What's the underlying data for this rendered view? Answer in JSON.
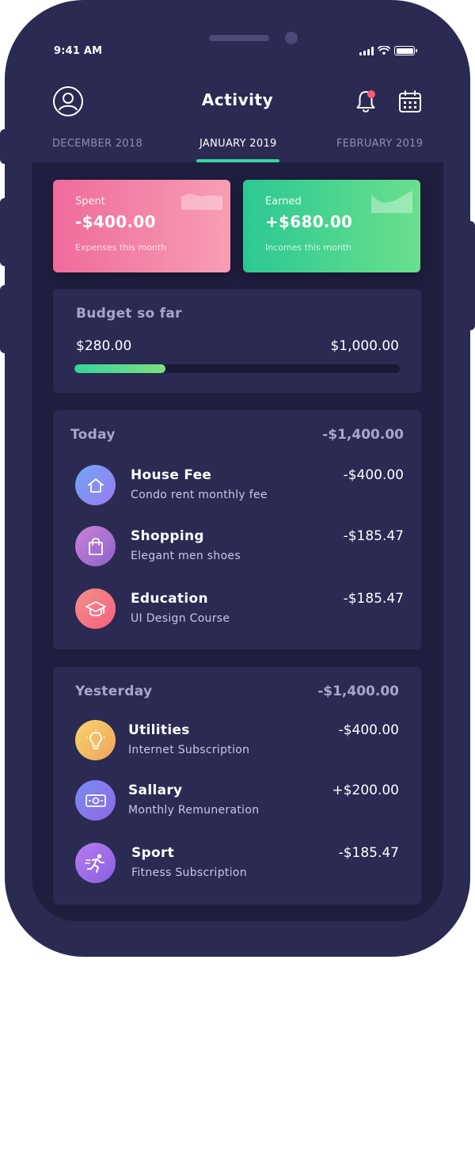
{
  "status_bar": {
    "time": "9:41 AM"
  },
  "header": {
    "title": "Activity"
  },
  "tabs": {
    "prev": "DECEMBER 2018",
    "active": "JANUARY 2019",
    "next": "FEBRUARY 2019"
  },
  "summary": {
    "spent": {
      "label": "Spent",
      "amount": "-$400.00",
      "sub": "Expenses this month"
    },
    "earned": {
      "label": "Earned",
      "amount": "+$680.00",
      "sub": "Incomes this month"
    }
  },
  "budget": {
    "title": "Budget so far",
    "spent": "$280.00",
    "limit": "$1,000.00",
    "progress_fraction": 0.28
  },
  "today": {
    "title": "Today",
    "total": "-$1,400.00",
    "items": [
      {
        "name": "House Fee",
        "desc": "Condo rent monthly fee",
        "amount": "-$400.00",
        "icon": "house-icon"
      },
      {
        "name": "Shopping",
        "desc": "Elegant men shoes",
        "amount": "-$185.47",
        "icon": "shopping-bag-icon"
      },
      {
        "name": "Education",
        "desc": "UI Design Course",
        "amount": "-$185.47",
        "icon": "graduation-cap-icon"
      }
    ]
  },
  "yesterday": {
    "title": "Yesterday",
    "total": "-$1,400.00",
    "items": [
      {
        "name": "Utilities",
        "desc": "Internet Subscription",
        "amount": "-$400.00",
        "icon": "lightbulb-icon"
      },
      {
        "name": "Sallary",
        "desc": "Monthly Remuneration",
        "amount": "+$200.00",
        "icon": "cash-icon"
      },
      {
        "name": "Sport",
        "desc": "Fitness Subscription",
        "amount": "-$185.47",
        "icon": "runner-icon"
      }
    ]
  },
  "colors": {
    "phone": "#2b2a52",
    "screen": "#1f1e3f",
    "accent": "#37d6a0",
    "notification": "#f45d79"
  }
}
